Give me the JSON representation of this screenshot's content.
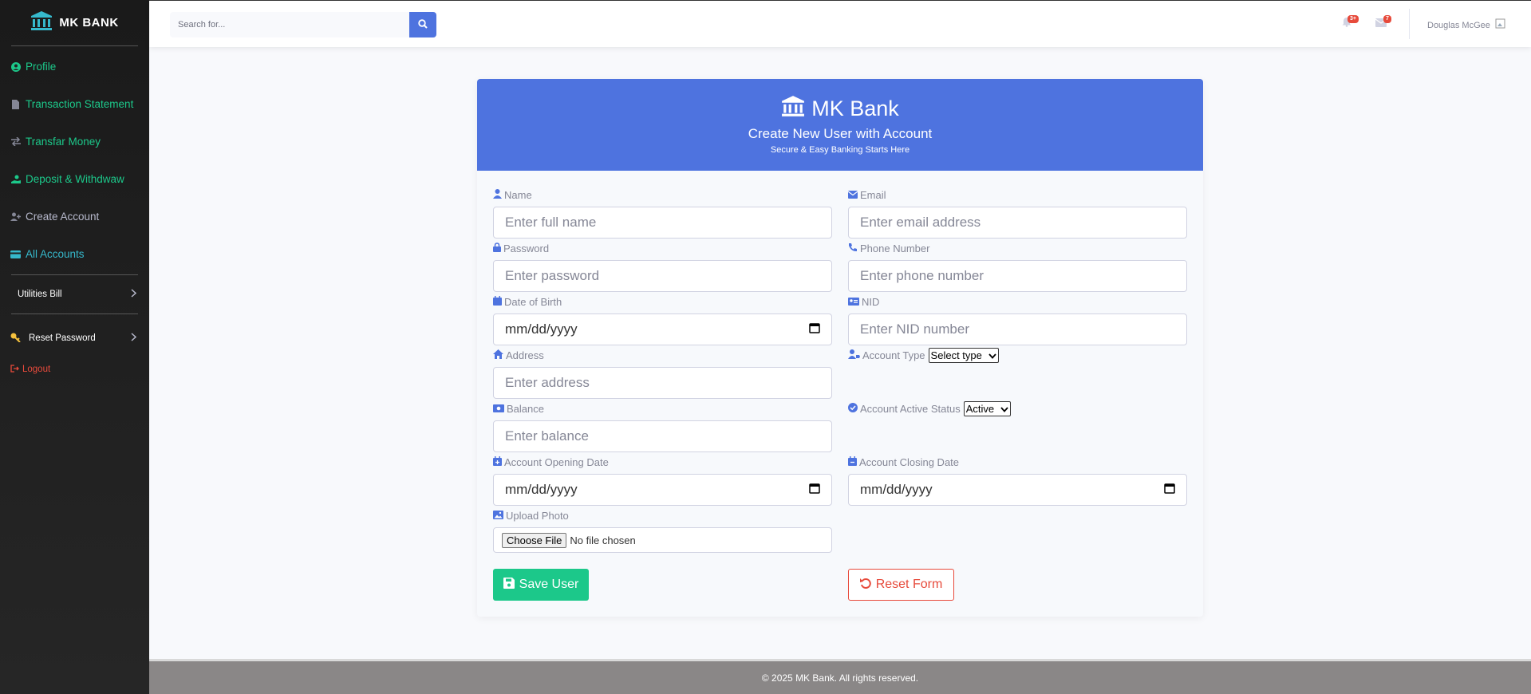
{
  "sidebar": {
    "brand": "MK BANK",
    "items": [
      {
        "label": "Profile"
      },
      {
        "label": "Transaction Statement"
      },
      {
        "label": "Transfar Money"
      },
      {
        "label": "Deposit & Withdwaw"
      },
      {
        "label": "Create Account"
      },
      {
        "label": "All Accounts"
      }
    ],
    "utilities": "Utilities Bill",
    "reset_password": "Reset Password",
    "logout": "Logout"
  },
  "topbar": {
    "search_placeholder": "Search for...",
    "alerts_badge": "3+",
    "messages_badge": "7",
    "user_name": "Douglas McGee"
  },
  "card": {
    "title": "MK Bank",
    "subtitle": "Create New User with Account",
    "tagline": "Secure & Easy Banking Starts Here"
  },
  "form": {
    "name_label": "Name",
    "name_placeholder": "Enter full name",
    "email_label": "Email",
    "email_placeholder": "Enter email address",
    "password_label": "Password",
    "password_placeholder": "Enter password",
    "phone_label": "Phone Number",
    "phone_placeholder": "Enter phone number",
    "dob_label": "Date of Birth",
    "date_placeholder": "mm/dd/yyyy",
    "nid_label": "NID",
    "nid_placeholder": "Enter NID number",
    "address_label": "Address",
    "address_placeholder": "Enter address",
    "account_type_label": "Account Type",
    "account_type_value": "Select type",
    "balance_label": "Balance",
    "balance_placeholder": "Enter balance",
    "status_label": "Account Active Status",
    "status_value": "Active",
    "opening_label": "Account Opening Date",
    "closing_label": "Account Closing Date",
    "photo_label": "Upload Photo",
    "choose_file": "Choose File",
    "no_file": "No file chosen",
    "save_label": "Save User",
    "reset_label": "Reset Form"
  },
  "footer": {
    "text": "© 2025 MK Bank. All rights reserved."
  },
  "colors": {
    "primary": "#4e73df",
    "success": "#1cc88a",
    "danger": "#e74a3b",
    "info": "#36b9cc"
  }
}
